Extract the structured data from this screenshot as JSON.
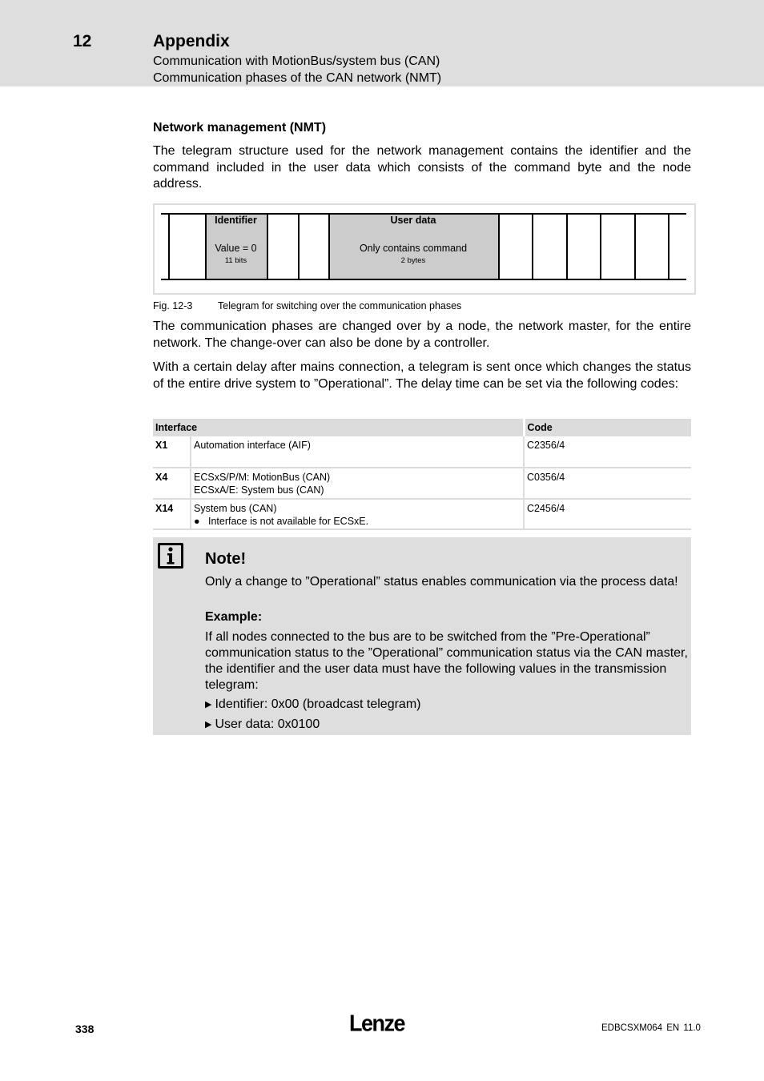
{
  "header": {
    "chapter_number": "12",
    "chapter_title": "Appendix",
    "breadcrumb": [
      "Communication with MotionBus/system bus (CAN)",
      "Communication phases of the CAN network (NMT)"
    ]
  },
  "section": {
    "heading": "Network management (NMT)",
    "intro": "The telegram structure used for the network management contains the identifier and the command included in the user data which consists of the command byte and the node address."
  },
  "diagram": {
    "identifier": {
      "title": "Identifier",
      "value": "Value = 0",
      "size": "11 bits"
    },
    "user_data": {
      "title": "User data",
      "value": "Only contains command",
      "size": "2 bytes"
    },
    "caption_number": "Fig. 12-3",
    "caption_text": "Telegram for switching over the communication phases"
  },
  "paragraphs": [
    "The communication phases are changed over by a node, the network master, for the entire network. The change-over can also be done by a controller.",
    "With a certain delay after mains connection, a telegram is sent once which changes the status of the entire drive system to ”Operational”. The delay time can be set via the following codes:"
  ],
  "table": {
    "headers": {
      "interface": "Interface",
      "code": "Code"
    },
    "rows": [
      {
        "connector": "X1",
        "lines": [
          "Automation interface (AIF)"
        ],
        "bullet": "",
        "code": "C2356/4"
      },
      {
        "connector": "X4",
        "lines": [
          "ECSxS/P/M: MotionBus (CAN)",
          "ECSxA/E: System bus (CAN)"
        ],
        "bullet": "",
        "code": "C0356/4"
      },
      {
        "connector": "X14",
        "lines": [
          "System bus (CAN)"
        ],
        "bullet": "Interface is not available for ECSxE.",
        "code": "C2456/4"
      }
    ]
  },
  "note": {
    "icon": "info-icon",
    "title": "Note!",
    "text": "Only a change to ”Operational” status enables communication via the process data!",
    "example_label": "Example:",
    "example_text": "If all nodes connected to the bus are to be switched from the ”Pre-Operational” communication status to the ”Operational” communication status via the CAN master, the identifier and the user data must have the following values in the transmission telegram:",
    "bullets": [
      "Identifier: 0x00 (broadcast telegram)",
      "User data: 0x0100"
    ]
  },
  "footer": {
    "page_number": "338",
    "logo": "Lenze",
    "doc_id": "EDBCSXM064  EN  11.0"
  }
}
